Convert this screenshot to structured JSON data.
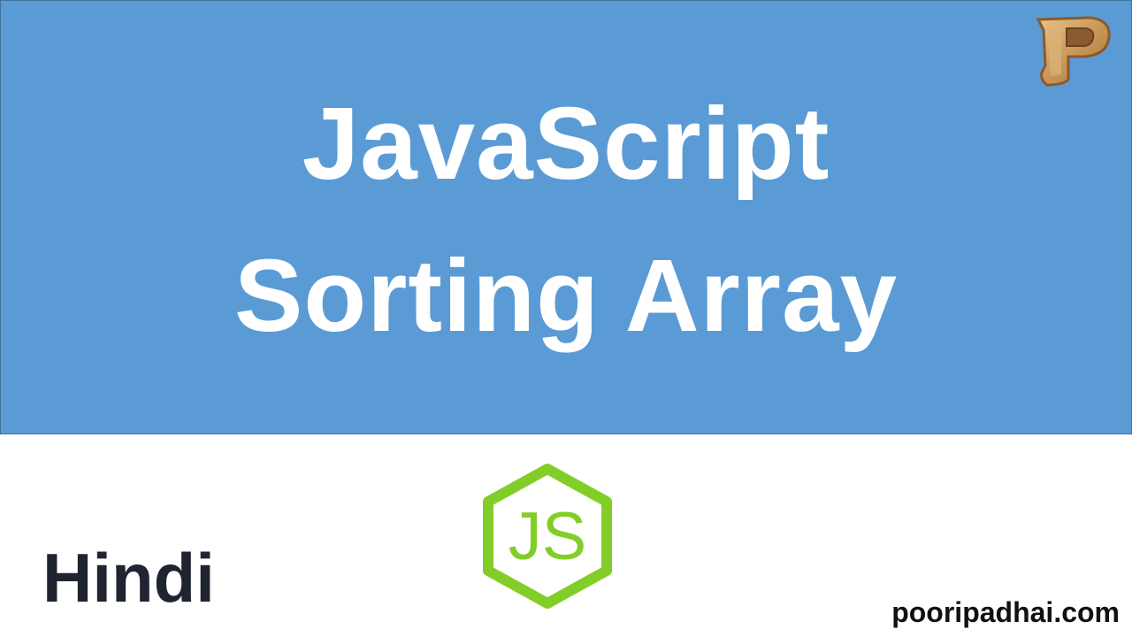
{
  "banner": {
    "title_line_1": "JavaScript",
    "title_line_2": "Sorting Array",
    "background_color": "#5b9bd5"
  },
  "logo": {
    "icon": "p-letter-logo-icon"
  },
  "footer": {
    "language_label": "Hindi",
    "js_logo_text": "JS",
    "js_logo_icon": "nodejs-hexagon-icon",
    "js_logo_color": "#83cd29",
    "site": "pooripadhai.com"
  }
}
